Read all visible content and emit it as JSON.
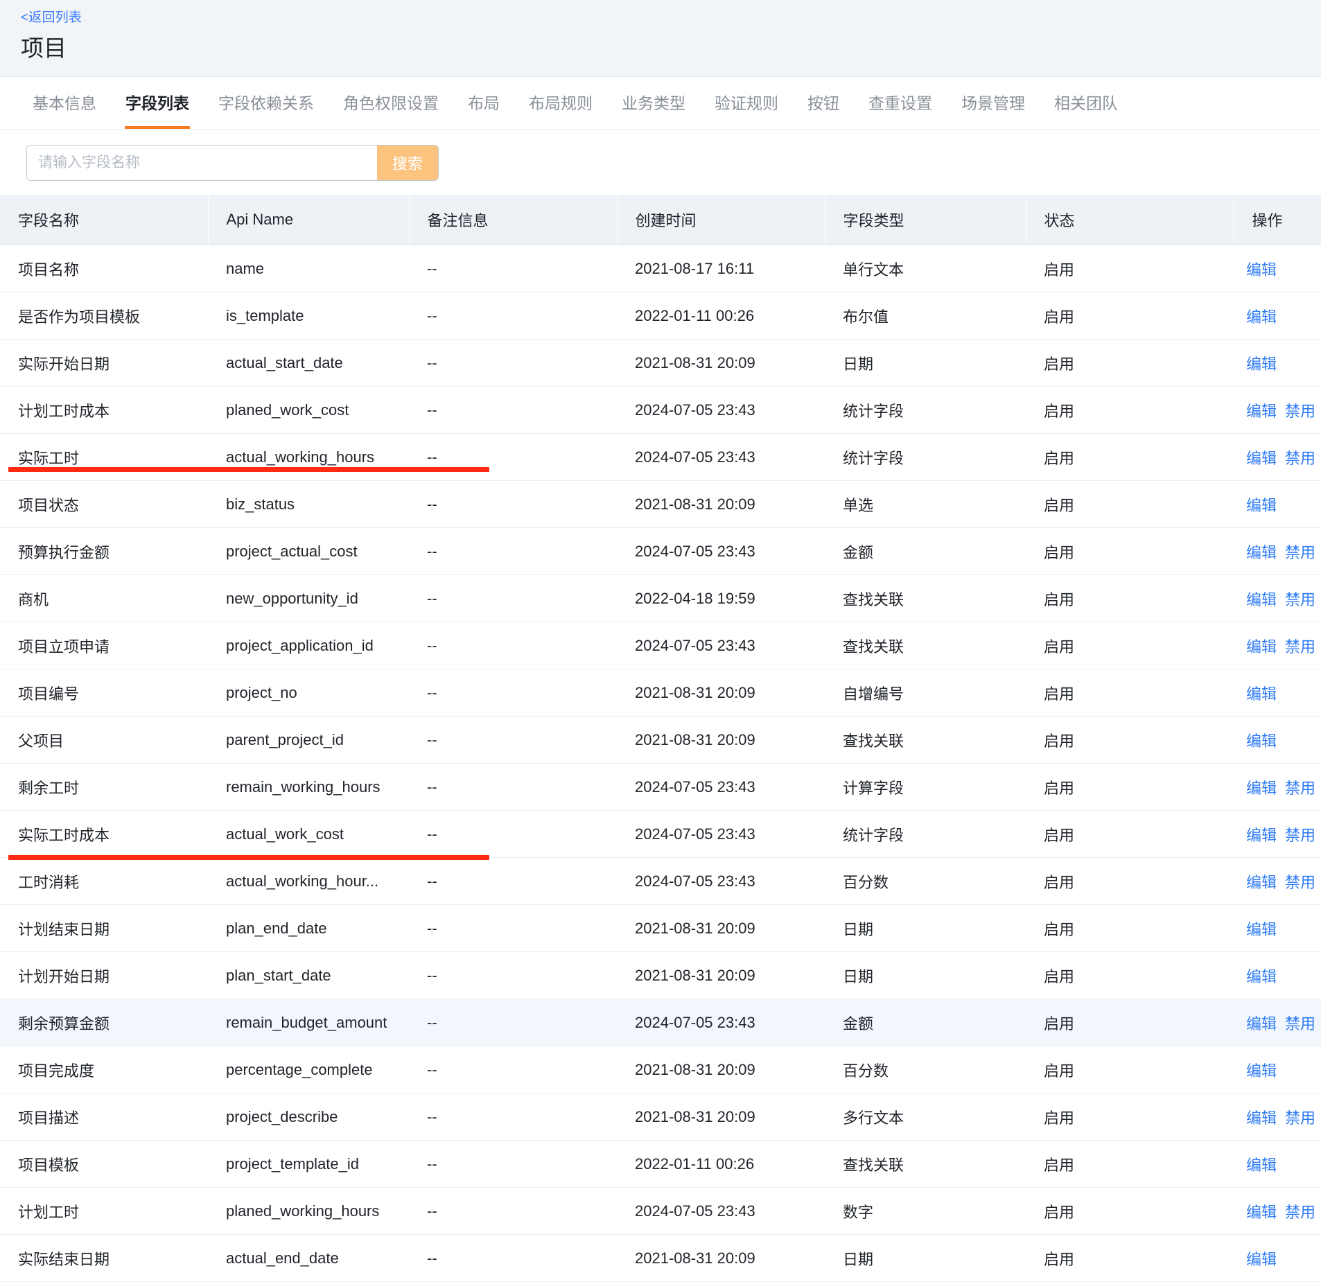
{
  "header": {
    "back_link": "<返回列表",
    "title": "项目"
  },
  "tabs": [
    {
      "label": "基本信息",
      "active": false
    },
    {
      "label": "字段列表",
      "active": true
    },
    {
      "label": "字段依赖关系",
      "active": false
    },
    {
      "label": "角色权限设置",
      "active": false
    },
    {
      "label": "布局",
      "active": false
    },
    {
      "label": "布局规则",
      "active": false
    },
    {
      "label": "业务类型",
      "active": false
    },
    {
      "label": "验证规则",
      "active": false
    },
    {
      "label": "按钮",
      "active": false
    },
    {
      "label": "查重设置",
      "active": false
    },
    {
      "label": "场景管理",
      "active": false
    },
    {
      "label": "相关团队",
      "active": false
    }
  ],
  "search": {
    "placeholder": "请输入字段名称",
    "value": "",
    "button_label": "搜索"
  },
  "table": {
    "columns": [
      "字段名称",
      "Api Name",
      "备注信息",
      "创建时间",
      "字段类型",
      "状态",
      "操作"
    ],
    "action_edit": "编辑",
    "action_disable": "禁用",
    "rows": [
      {
        "name": "项目名称",
        "api": "name",
        "remark": "--",
        "created": "2021-08-17 16:11",
        "type": "单行文本",
        "status": "启用",
        "actions": [
          "编辑"
        ],
        "highlight": false
      },
      {
        "name": "是否作为项目模板",
        "api": "is_template",
        "remark": "--",
        "created": "2022-01-11 00:26",
        "type": "布尔值",
        "status": "启用",
        "actions": [
          "编辑"
        ],
        "highlight": false
      },
      {
        "name": "实际开始日期",
        "api": "actual_start_date",
        "remark": "--",
        "created": "2021-08-31 20:09",
        "type": "日期",
        "status": "启用",
        "actions": [
          "编辑"
        ],
        "highlight": false
      },
      {
        "name": "计划工时成本",
        "api": "planed_work_cost",
        "remark": "--",
        "created": "2024-07-05 23:43",
        "type": "统计字段",
        "status": "启用",
        "actions": [
          "编辑",
          "禁用"
        ],
        "highlight": false
      },
      {
        "name": "实际工时",
        "api": "actual_working_hours",
        "remark": "--",
        "created": "2024-07-05 23:43",
        "type": "统计字段",
        "status": "启用",
        "actions": [
          "编辑",
          "禁用"
        ],
        "highlight": false
      },
      {
        "name": "项目状态",
        "api": "biz_status",
        "remark": "--",
        "created": "2021-08-31 20:09",
        "type": "单选",
        "status": "启用",
        "actions": [
          "编辑"
        ],
        "highlight": false
      },
      {
        "name": "预算执行金额",
        "api": "project_actual_cost",
        "remark": "--",
        "created": "2024-07-05 23:43",
        "type": "金额",
        "status": "启用",
        "actions": [
          "编辑",
          "禁用"
        ],
        "highlight": false
      },
      {
        "name": "商机",
        "api": "new_opportunity_id",
        "remark": "--",
        "created": "2022-04-18 19:59",
        "type": "查找关联",
        "status": "启用",
        "actions": [
          "编辑",
          "禁用"
        ],
        "highlight": false
      },
      {
        "name": "项目立项申请",
        "api": "project_application_id",
        "remark": "--",
        "created": "2024-07-05 23:43",
        "type": "查找关联",
        "status": "启用",
        "actions": [
          "编辑",
          "禁用"
        ],
        "highlight": false
      },
      {
        "name": "项目编号",
        "api": "project_no",
        "remark": "--",
        "created": "2021-08-31 20:09",
        "type": "自增编号",
        "status": "启用",
        "actions": [
          "编辑"
        ],
        "highlight": false
      },
      {
        "name": "父项目",
        "api": "parent_project_id",
        "remark": "--",
        "created": "2021-08-31 20:09",
        "type": "查找关联",
        "status": "启用",
        "actions": [
          "编辑"
        ],
        "highlight": false
      },
      {
        "name": "剩余工时",
        "api": "remain_working_hours",
        "remark": "--",
        "created": "2024-07-05 23:43",
        "type": "计算字段",
        "status": "启用",
        "actions": [
          "编辑",
          "禁用"
        ],
        "highlight": false
      },
      {
        "name": "实际工时成本",
        "api": "actual_work_cost",
        "remark": "--",
        "created": "2024-07-05 23:43",
        "type": "统计字段",
        "status": "启用",
        "actions": [
          "编辑",
          "禁用"
        ],
        "highlight": false
      },
      {
        "name": "工时消耗",
        "api": "actual_working_hour...",
        "remark": "--",
        "created": "2024-07-05 23:43",
        "type": "百分数",
        "status": "启用",
        "actions": [
          "编辑",
          "禁用"
        ],
        "highlight": false
      },
      {
        "name": "计划结束日期",
        "api": "plan_end_date",
        "remark": "--",
        "created": "2021-08-31 20:09",
        "type": "日期",
        "status": "启用",
        "actions": [
          "编辑"
        ],
        "highlight": false
      },
      {
        "name": "计划开始日期",
        "api": "plan_start_date",
        "remark": "--",
        "created": "2021-08-31 20:09",
        "type": "日期",
        "status": "启用",
        "actions": [
          "编辑"
        ],
        "highlight": false
      },
      {
        "name": "剩余预算金额",
        "api": "remain_budget_amount",
        "remark": "--",
        "created": "2024-07-05 23:43",
        "type": "金额",
        "status": "启用",
        "actions": [
          "编辑",
          "禁用"
        ],
        "highlight": true
      },
      {
        "name": "项目完成度",
        "api": "percentage_complete",
        "remark": "--",
        "created": "2021-08-31 20:09",
        "type": "百分数",
        "status": "启用",
        "actions": [
          "编辑"
        ],
        "highlight": false
      },
      {
        "name": "项目描述",
        "api": "project_describe",
        "remark": "--",
        "created": "2021-08-31 20:09",
        "type": "多行文本",
        "status": "启用",
        "actions": [
          "编辑",
          "禁用"
        ],
        "highlight": false
      },
      {
        "name": "项目模板",
        "api": "project_template_id",
        "remark": "--",
        "created": "2022-01-11 00:26",
        "type": "查找关联",
        "status": "启用",
        "actions": [
          "编辑"
        ],
        "highlight": false
      },
      {
        "name": "计划工时",
        "api": "planed_working_hours",
        "remark": "--",
        "created": "2024-07-05 23:43",
        "type": "数字",
        "status": "启用",
        "actions": [
          "编辑",
          "禁用"
        ],
        "highlight": false
      },
      {
        "name": "实际结束日期",
        "api": "actual_end_date",
        "remark": "--",
        "created": "2021-08-31 20:09",
        "type": "日期",
        "status": "启用",
        "actions": [
          "编辑"
        ],
        "highlight": false
      }
    ]
  },
  "annotations": [
    {
      "name": "red-underline-project-actual-cost",
      "color": "#fb2a10"
    },
    {
      "name": "red-underline-remain-budget-amount",
      "color": "#fb2a10"
    }
  ]
}
